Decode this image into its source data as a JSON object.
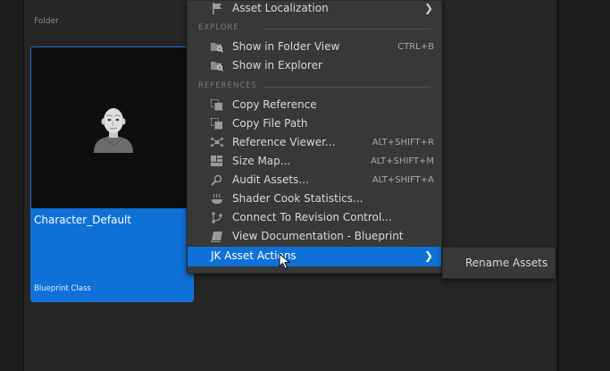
{
  "folder_label": "Folder",
  "asset": {
    "name": "Character_Default",
    "class": "Blueprint Class",
    "icon": "character-icon"
  },
  "menu": {
    "top_item": {
      "label": "Asset Localization",
      "icon": "flag-icon",
      "has_submenu": true
    },
    "sections": {
      "explore": "EXPLORE",
      "references": "REFERENCES"
    },
    "explore_items": [
      {
        "label": "Show in Folder View",
        "shortcut": "CTRL+B",
        "icon": "folder-search-icon"
      },
      {
        "label": "Show in Explorer",
        "shortcut": "",
        "icon": "folder-search-icon"
      }
    ],
    "reference_items": [
      {
        "label": "Copy Reference",
        "shortcut": "",
        "icon": "copy-icon"
      },
      {
        "label": "Copy File Path",
        "shortcut": "",
        "icon": "copy-icon"
      },
      {
        "label": "Reference Viewer...",
        "shortcut": "ALT+SHIFT+R",
        "icon": "reference-viewer-icon"
      },
      {
        "label": "Size Map...",
        "shortcut": "ALT+SHIFT+M",
        "icon": "size-map-icon"
      },
      {
        "label": "Audit Assets...",
        "shortcut": "ALT+SHIFT+A",
        "icon": "audit-icon"
      },
      {
        "label": "Shader Cook Statistics...",
        "shortcut": "",
        "icon": "shader-stats-icon"
      },
      {
        "label": "Connect To Revision Control...",
        "shortcut": "",
        "icon": "revision-control-icon"
      },
      {
        "label": "View Documentation - Blueprint",
        "shortcut": "",
        "icon": "documentation-icon"
      }
    ],
    "highlighted_item": {
      "label": "JK Asset Actions",
      "has_submenu": true
    }
  },
  "submenu": {
    "items": [
      {
        "label": "Rename Assets"
      }
    ]
  },
  "colors": {
    "accent": "#0f70d7",
    "menu_bg": "#383838",
    "panel_bg": "#262626"
  }
}
